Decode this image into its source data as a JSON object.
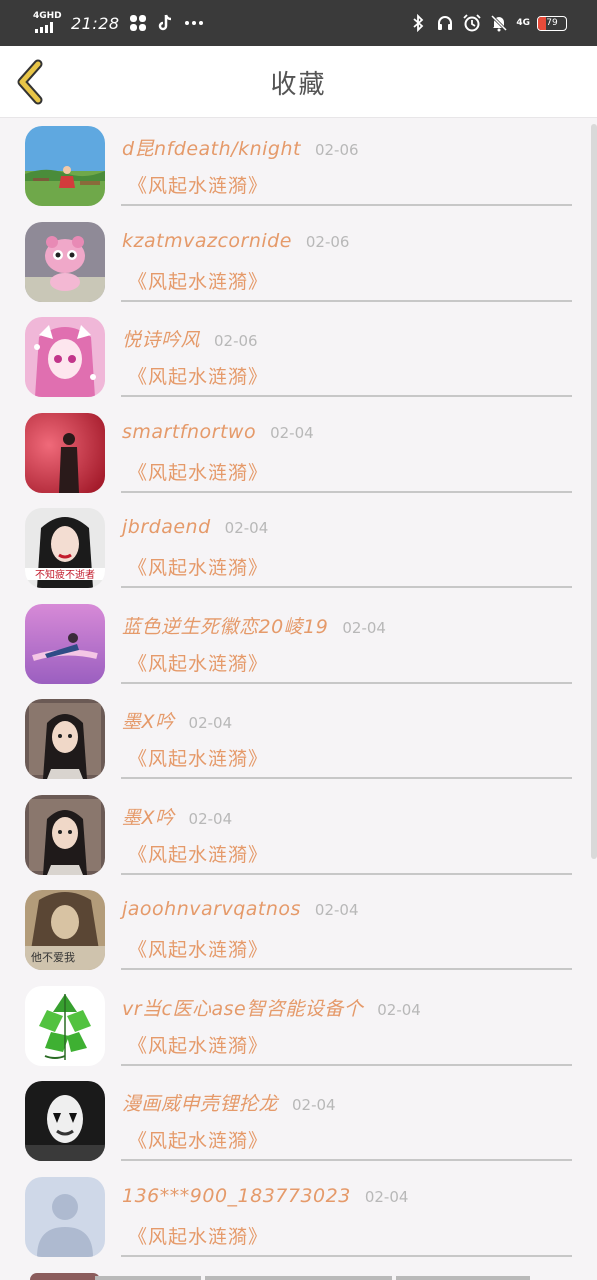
{
  "status_bar": {
    "network_label": "4GHD",
    "time": "21:28",
    "network_label_right": "4G",
    "battery_text": "79",
    "icons_left": [
      "signal-icon",
      "fan-icon",
      "tiktok-icon",
      "more-dots-icon"
    ],
    "icons_right": [
      "bluetooth-icon",
      "headphones-icon",
      "alarm-icon",
      "mute-bell-icon",
      "battery-icon"
    ]
  },
  "nav": {
    "title": "收藏",
    "back_icon": "chevron-left-icon"
  },
  "rows": [
    {
      "name": "d昆nfdeath/knight",
      "date": "02-06",
      "story": "《风起水涟漪》",
      "avatar": "landscape-girl"
    },
    {
      "name": "kzatmvazcornide",
      "date": "02-06",
      "story": "《风起水涟漪》",
      "avatar": "pink-plush"
    },
    {
      "name": "悦诗吟风",
      "date": "02-06",
      "story": "《风起水涟漪》",
      "avatar": "anime-pink-girl"
    },
    {
      "name": "smartfnortwo",
      "date": "02-04",
      "story": "《风起水涟漪》",
      "avatar": "red-silhouette"
    },
    {
      "name": "jbrdaend",
      "date": "02-04",
      "story": "《风起水涟漪》",
      "avatar": "woman-portrait"
    },
    {
      "name": "蓝色逆生死徽恋20崚19",
      "date": "02-04",
      "story": "《风起水涟漪》",
      "avatar": "pink-sky"
    },
    {
      "name": "墨X吟",
      "date": "02-04",
      "story": "《风起水涟漪》",
      "avatar": "ancient-man"
    },
    {
      "name": "墨X吟",
      "date": "02-04",
      "story": "《风起水涟漪》",
      "avatar": "ancient-man"
    },
    {
      "name": "jaoohnvarvqatnos",
      "date": "02-04",
      "story": "《风起水涟漪》",
      "avatar": "sepia-girl"
    },
    {
      "name": "vr当c医心ase智咨能设备个",
      "date": "02-04",
      "story": "《风起水涟漪》",
      "avatar": "zongzi"
    },
    {
      "name": "漫画威申壳锂抡龙",
      "date": "02-04",
      "story": "《风起水涟漪》",
      "avatar": "mime-face"
    },
    {
      "name": "136***900_183773023",
      "date": "02-04",
      "story": "《风起水涟漪》",
      "avatar": "default-user"
    }
  ],
  "avatar_captions": {
    "woman-portrait": "不知疲不逝者",
    "sepia-girl": "他不爱我"
  },
  "colors": {
    "accent_text": "#e59a6a",
    "date_text": "#b8b8b8",
    "back_icon": "#e8c547",
    "status_bar_bg": "#3a3a3a"
  }
}
